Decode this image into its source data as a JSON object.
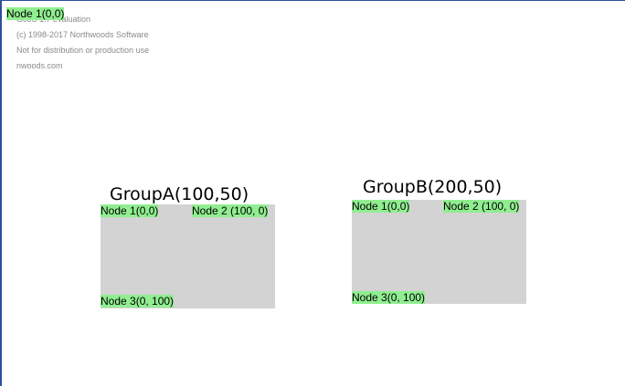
{
  "watermark": {
    "lines": [
      "GoJS 1.7 evaluation",
      "(c) 1998-2017 Northwoods Software",
      "Not for distribution or production use",
      "nwoods.com"
    ]
  },
  "top_node": {
    "label": "Node 1(0,0)"
  },
  "groups": [
    {
      "title": "GroupA(100,50)",
      "nodes": [
        "Node 1(0,0)",
        "Node 2 (100, 0)",
        "Node 3(0, 100)"
      ]
    },
    {
      "title": "GroupB(200,50)",
      "nodes": [
        "Node 1(0,0)",
        "Node 2 (100, 0)",
        "Node 3(0, 100)"
      ]
    }
  ],
  "colors": {
    "node_fill": "#90ee90",
    "group_fill": "#d3d3d3",
    "border": "#2e4f9e",
    "watermark_text": "#8a8a8a"
  }
}
